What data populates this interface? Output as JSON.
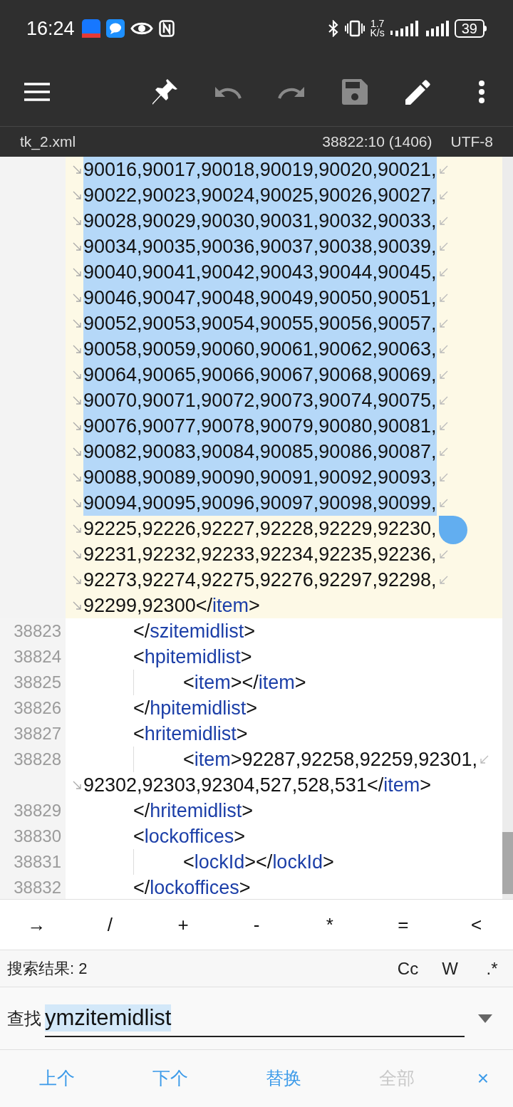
{
  "status_bar": {
    "time": "16:24",
    "speed_value": "1.7",
    "speed_unit": "K/s",
    "battery": "39"
  },
  "toolbar": {
    "undo": {
      "disabled": true
    },
    "redo": {
      "disabled": true
    },
    "save": {
      "disabled": true
    }
  },
  "file_bar": {
    "file_name": "tk_2.xml",
    "position": "38822:10 (1406)",
    "encoding": "UTF-8"
  },
  "editor": {
    "lines": [
      {
        "current": true,
        "rows": [
          {
            "continuation": true,
            "continues": true,
            "selected": true,
            "parts": [
              {
                "kind": "text",
                "text": "90016,90017,90018,90019,90020,90021,"
              }
            ]
          },
          {
            "continuation": true,
            "continues": true,
            "selected": true,
            "parts": [
              {
                "kind": "text",
                "text": "90022,90023,90024,90025,90026,90027,"
              }
            ]
          },
          {
            "continuation": true,
            "continues": true,
            "selected": true,
            "parts": [
              {
                "kind": "text",
                "text": "90028,90029,90030,90031,90032,90033,"
              }
            ]
          },
          {
            "continuation": true,
            "continues": true,
            "selected": true,
            "parts": [
              {
                "kind": "text",
                "text": "90034,90035,90036,90037,90038,90039,"
              }
            ]
          },
          {
            "continuation": true,
            "continues": true,
            "selected": true,
            "parts": [
              {
                "kind": "text",
                "text": "90040,90041,90042,90043,90044,90045,"
              }
            ]
          },
          {
            "continuation": true,
            "continues": true,
            "selected": true,
            "parts": [
              {
                "kind": "text",
                "text": "90046,90047,90048,90049,90050,90051,"
              }
            ]
          },
          {
            "continuation": true,
            "continues": true,
            "selected": true,
            "parts": [
              {
                "kind": "text",
                "text": "90052,90053,90054,90055,90056,90057,"
              }
            ]
          },
          {
            "continuation": true,
            "continues": true,
            "selected": true,
            "parts": [
              {
                "kind": "text",
                "text": "90058,90059,90060,90061,90062,90063,"
              }
            ]
          },
          {
            "continuation": true,
            "continues": true,
            "selected": true,
            "parts": [
              {
                "kind": "text",
                "text": "90064,90065,90066,90067,90068,90069,"
              }
            ]
          },
          {
            "continuation": true,
            "continues": true,
            "selected": true,
            "parts": [
              {
                "kind": "text",
                "text": "90070,90071,90072,90073,90074,90075,"
              }
            ]
          },
          {
            "continuation": true,
            "continues": true,
            "selected": true,
            "parts": [
              {
                "kind": "text",
                "text": "90076,90077,90078,90079,90080,90081,"
              }
            ]
          },
          {
            "continuation": true,
            "continues": true,
            "selected": true,
            "parts": [
              {
                "kind": "text",
                "text": "90082,90083,90084,90085,90086,90087,"
              }
            ]
          },
          {
            "continuation": true,
            "continues": true,
            "selected": true,
            "parts": [
              {
                "kind": "text",
                "text": "90088,90089,90090,90091,90092,90093,"
              }
            ]
          },
          {
            "continuation": true,
            "continues": true,
            "selected": true,
            "parts": [
              {
                "kind": "text",
                "text": "90094,90095,90096,90097,90098,90099,"
              }
            ]
          },
          {
            "continuation": true,
            "continues": false,
            "selected": false,
            "parts": [
              {
                "kind": "text",
                "text": "92225,92226,92227,92228,92229,92230,"
              }
            ]
          },
          {
            "continuation": true,
            "continues": true,
            "selected": false,
            "parts": [
              {
                "kind": "text",
                "text": "92231,92232,92233,92234,92235,92236,"
              }
            ]
          },
          {
            "continuation": true,
            "continues": true,
            "selected": false,
            "parts": [
              {
                "kind": "text",
                "text": "92273,92274,92275,92276,92297,92298,"
              }
            ]
          },
          {
            "continuation": true,
            "continues": false,
            "selected": false,
            "parts": [
              {
                "kind": "text",
                "text": "92299,92300</"
              },
              {
                "kind": "tag",
                "text": "item"
              },
              {
                "kind": "text",
                "text": ">"
              }
            ]
          }
        ]
      },
      {
        "number": "38823",
        "current": false,
        "rows": [
          {
            "continuation": false,
            "continues": false,
            "selected": false,
            "parts": [
              {
                "kind": "text",
                "text": "</"
              },
              {
                "kind": "tag",
                "text": "szitemidlist"
              },
              {
                "kind": "text",
                "text": ">"
              }
            ]
          }
        ]
      },
      {
        "number": "38824",
        "current": false,
        "rows": [
          {
            "continuation": false,
            "continues": false,
            "selected": false,
            "parts": [
              {
                "kind": "text",
                "text": "<"
              },
              {
                "kind": "tag",
                "text": "hpitemidlist"
              },
              {
                "kind": "text",
                "text": ">"
              }
            ]
          }
        ],
        "children": [
          {
            "number": "38825",
            "current": false,
            "rows": [
              {
                "continuation": false,
                "continues": false,
                "selected": false,
                "parts": [
                  {
                    "kind": "text",
                    "text": "<"
                  },
                  {
                    "kind": "tag",
                    "text": "item"
                  },
                  {
                    "kind": "text",
                    "text": "></"
                  },
                  {
                    "kind": "tag",
                    "text": "item"
                  },
                  {
                    "kind": "text",
                    "text": ">"
                  }
                ]
              }
            ]
          }
        ]
      },
      {
        "number": "38826",
        "current": false,
        "rows": [
          {
            "continuation": false,
            "continues": false,
            "selected": false,
            "parts": [
              {
                "kind": "text",
                "text": "</"
              },
              {
                "kind": "tag",
                "text": "hpitemidlist"
              },
              {
                "kind": "text",
                "text": ">"
              }
            ]
          }
        ]
      },
      {
        "number": "38827",
        "current": false,
        "rows": [
          {
            "continuation": false,
            "continues": false,
            "selected": false,
            "parts": [
              {
                "kind": "text",
                "text": "<"
              },
              {
                "kind": "tag",
                "text": "hritemidlist"
              },
              {
                "kind": "text",
                "text": ">"
              }
            ]
          }
        ],
        "children": [
          {
            "number": "38828",
            "current": false,
            "rows": [
              {
                "continuation": false,
                "continues": true,
                "selected": false,
                "parts": [
                  {
                    "kind": "text",
                    "text": "<"
                  },
                  {
                    "kind": "tag",
                    "text": "item"
                  },
                  {
                    "kind": "text",
                    "text": ">92287,92258,92259,92301,"
                  }
                ]
              },
              {
                "continuation": true,
                "continues": false,
                "selected": false,
                "parts": [
                  {
                    "kind": "text",
                    "text": "92302,92303,92304,527,528,531</"
                  },
                  {
                    "kind": "tag",
                    "text": "item"
                  },
                  {
                    "kind": "text",
                    "text": ">"
                  }
                ]
              }
            ]
          }
        ]
      },
      {
        "number": "38829",
        "current": false,
        "rows": [
          {
            "continuation": false,
            "continues": false,
            "selected": false,
            "parts": [
              {
                "kind": "text",
                "text": "</"
              },
              {
                "kind": "tag",
                "text": "hritemidlist"
              },
              {
                "kind": "text",
                "text": ">"
              }
            ]
          }
        ]
      },
      {
        "number": "38830",
        "current": false,
        "rows": [
          {
            "continuation": false,
            "continues": false,
            "selected": false,
            "parts": [
              {
                "kind": "text",
                "text": "<"
              },
              {
                "kind": "tag",
                "text": "lockoffices"
              },
              {
                "kind": "text",
                "text": ">"
              }
            ]
          }
        ],
        "children": [
          {
            "number": "38831",
            "current": false,
            "rows": [
              {
                "continuation": false,
                "continues": false,
                "selected": false,
                "parts": [
                  {
                    "kind": "text",
                    "text": "<"
                  },
                  {
                    "kind": "tag",
                    "text": "lockId"
                  },
                  {
                    "kind": "text",
                    "text": "></"
                  },
                  {
                    "kind": "tag",
                    "text": "lockId"
                  },
                  {
                    "kind": "text",
                    "text": ">"
                  }
                ]
              }
            ]
          }
        ]
      },
      {
        "number": "38832",
        "current": false,
        "rows": [
          {
            "continuation": false,
            "continues": false,
            "selected": false,
            "parts": [
              {
                "kind": "text",
                "text": "</"
              },
              {
                "kind": "tag",
                "text": "lockoffices"
              },
              {
                "kind": "text",
                "text": ">"
              }
            ]
          }
        ]
      }
    ]
  },
  "symbol_keys": [
    "→",
    "/",
    "+",
    "-",
    "*",
    "=",
    "<"
  ],
  "search": {
    "result_label": "搜索结果: 2",
    "options": [
      "Cc",
      "W",
      ".*"
    ],
    "find_label": "查找",
    "find_value": "ymzitemidlist",
    "value_selected": true
  },
  "actions": [
    {
      "label": "上个",
      "disabled": false
    },
    {
      "label": "下个",
      "disabled": false
    },
    {
      "label": "替换",
      "disabled": false
    },
    {
      "label": "全部",
      "disabled": true
    },
    {
      "label": "×",
      "disabled": false
    }
  ]
}
